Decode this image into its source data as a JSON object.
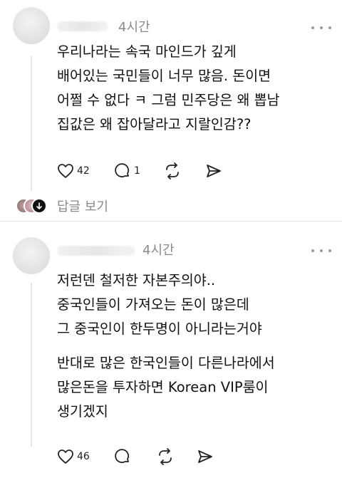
{
  "posts": [
    {
      "time": "4시간",
      "lines": [
        "우리나라는 속국 마인드가 깊게",
        "배어있는 국민들이 너무 많음. 돈이면",
        "어쩔 수 없다 ㅋ 그럼 민주당은 왜 뽑남",
        "집값은 왜 잡아달라고 지랄인감??"
      ],
      "likes": "42",
      "comments": "1",
      "replies_label": "답글 보기"
    },
    {
      "time": "4시간",
      "lines": [
        "저런덴 철저한 자본주의야..",
        "중국인들이 가져오는 돈이 많은데",
        "그 중국인이 한두명이 아니라는거야",
        "",
        "반대로 많은 한국인들이 다른나라에서",
        "많은돈을 투자하면  Korean VIP룸이",
        "생기겠지"
      ],
      "likes": "46"
    }
  ],
  "icons": {
    "like": "heart-icon",
    "comment": "comment-icon",
    "repost": "repost-icon",
    "share": "share-icon",
    "more": "more-icon"
  },
  "colors": {
    "muted": "#8a8a8a",
    "text": "#111111",
    "divider": "#e4e4e4"
  }
}
